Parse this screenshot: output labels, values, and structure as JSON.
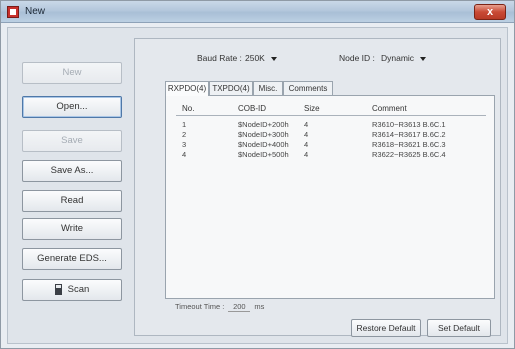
{
  "window": {
    "title": "New",
    "close_label": "x"
  },
  "sidebar": {
    "buttons": [
      {
        "label": "New",
        "state": "disabled"
      },
      {
        "label": "Open...",
        "state": "active"
      },
      {
        "label": "Save",
        "state": "disabled"
      },
      {
        "label": "Save As...",
        "state": "normal"
      },
      {
        "label": "Read",
        "state": "normal"
      },
      {
        "label": "Write",
        "state": "normal"
      },
      {
        "label": "Generate EDS...",
        "state": "normal"
      },
      {
        "label": "Scan",
        "state": "normal",
        "icon": "device-icon"
      }
    ]
  },
  "settings": {
    "baud_rate_label": "Baud Rate :",
    "baud_rate_value": "250K",
    "node_id_label": "Node ID :",
    "node_id_value": "Dynamic"
  },
  "tabs": [
    {
      "label": "RXPDO(4)",
      "selected": true
    },
    {
      "label": "TXPDO(4)",
      "selected": false
    },
    {
      "label": "Misc.",
      "selected": false
    },
    {
      "label": "Comments",
      "selected": false
    }
  ],
  "grid": {
    "columns": [
      "No.",
      "COB-ID",
      "Size",
      "Comment"
    ],
    "rows": [
      {
        "no": "1",
        "cobid": "$NodeID+200h",
        "size": "4",
        "comment": "R3610~R3613 B.6C.1"
      },
      {
        "no": "2",
        "cobid": "$NodeID+300h",
        "size": "4",
        "comment": "R3614~R3617 B.6C.2"
      },
      {
        "no": "3",
        "cobid": "$NodeID+400h",
        "size": "4",
        "comment": "R3618~R3621 B.6C.3"
      },
      {
        "no": "4",
        "cobid": "$NodeID+500h",
        "size": "4",
        "comment": "R3622~R3625 B.6C.4"
      }
    ]
  },
  "timeout": {
    "label": "Timeout Time :",
    "value": "200",
    "unit": "ms"
  },
  "footer": {
    "restore_label": "Restore Default",
    "set_label": "Set Default"
  }
}
